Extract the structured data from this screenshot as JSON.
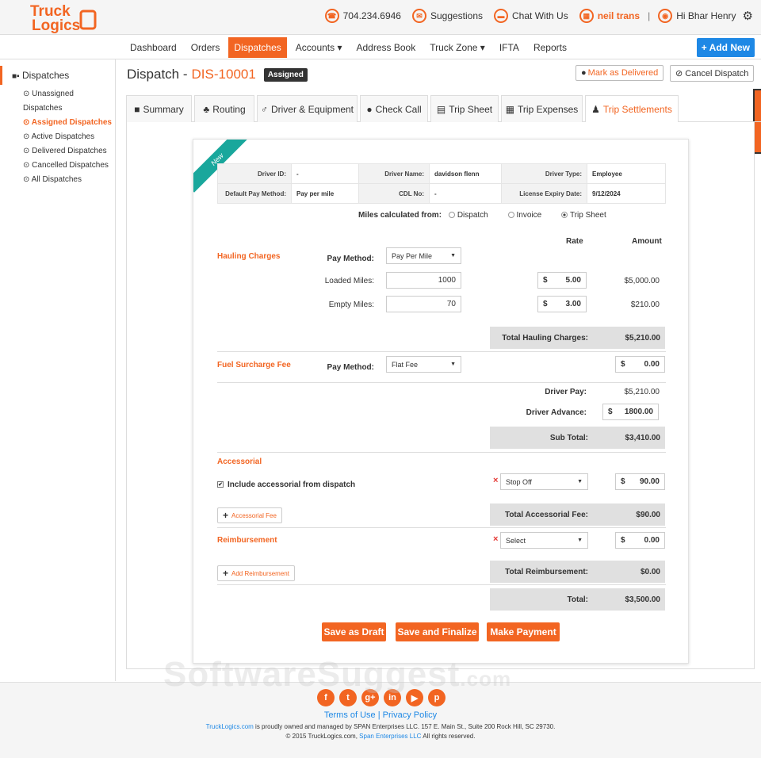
{
  "brand": {
    "name_top": "Truck",
    "name_bottom": "Logics",
    "accent": "#f26522",
    "blue": "#1e88e5",
    "teal": "#19a79c"
  },
  "topbar": {
    "phone": "704.234.6946",
    "suggestions": "Suggestions",
    "chat": "Chat With Us",
    "company": "neil trans",
    "separator": "|",
    "greeting": "Hi Bhar Henry"
  },
  "nav": {
    "items": [
      "Dashboard",
      "Orders",
      "Dispatches",
      "Accounts ▾",
      "Address Book",
      "Truck Zone ▾",
      "IFTA",
      "Reports"
    ],
    "add_new": "+ Add New"
  },
  "sidebar": {
    "header": "Dispatches",
    "items": [
      "Unassigned Dispatches",
      "Assigned Dispatches",
      "Active Dispatches",
      "Delivered Dispatches",
      "Cancelled Dispatches",
      "All Dispatches"
    ]
  },
  "page": {
    "title": "Dispatch -",
    "id": "DIS-10001",
    "status": "Assigned",
    "mark_delivered": "Mark as Delivered",
    "cancel": "Cancel Dispatch"
  },
  "tabs": [
    "Summary",
    "Routing",
    "Driver & Equipment",
    "Check Call",
    "Trip Sheet",
    "Trip Expenses",
    "Trip Settlements"
  ],
  "card": {
    "ribbon": "New",
    "info": {
      "driver_id_label": "Driver ID:",
      "driver_id": "-",
      "driver_name_label": "Driver Name:",
      "driver_name": "davidson flenn",
      "driver_type_label": "Driver Type:",
      "driver_type": "Employee",
      "pay_method_label": "Default Pay Method:",
      "pay_method": "Pay per mile",
      "cdl_label": "CDL No:",
      "cdl": "-",
      "license_label": "License Expiry Date:",
      "license": "9/12/2024"
    },
    "miles_from": {
      "label": "Miles calculated from:",
      "options": [
        "Dispatch",
        "Invoice",
        "Trip Sheet"
      ],
      "selected": "Trip Sheet"
    },
    "rate_header": "Rate",
    "amount_header": "Amount",
    "hauling": {
      "title": "Hauling Charges",
      "pay_method_label": "Pay Method:",
      "pay_method": "Pay Per Mile",
      "loaded_label": "Loaded Miles:",
      "loaded": "1000",
      "loaded_rate": "5.00",
      "loaded_amount": "$5,000.00",
      "empty_label": "Empty Miles:",
      "empty": "70",
      "empty_rate": "3.00",
      "empty_amount": "$210.00",
      "total_label": "Total Hauling Charges:",
      "total": "$5,210.00"
    },
    "fuel": {
      "title": "Fuel Surcharge Fee",
      "pay_method_label": "Pay Method:",
      "pay_method": "Flat Fee",
      "amount": "0.00"
    },
    "pay": {
      "driver_pay_label": "Driver Pay:",
      "driver_pay": "$5,210.00",
      "advance_label": "Driver Advance:",
      "advance": "1800.00",
      "subtotal_label": "Sub Total:",
      "subtotal": "$3,410.00"
    },
    "accessorial": {
      "title": "Accessorial",
      "include_label": "Include accessorial from dispatch",
      "type": "Stop Off",
      "amount": "90.00",
      "add_label": "Accessorial Fee",
      "total_label": "Total Accessorial Fee:",
      "total": "$90.00"
    },
    "reimbursement": {
      "title": "Reimbursement",
      "type": "Select",
      "amount": "0.00",
      "add_label": "Add Reimbursement",
      "total_label": "Total Reimbursement:",
      "total": "$0.00"
    },
    "grand_total_label": "Total:",
    "grand_total": "$3,500.00",
    "currency": "$",
    "buttons": {
      "draft": "Save as Draft",
      "finalize": "Save and Finalize",
      "payment": "Make Payment"
    }
  },
  "watermark": {
    "main": "SoftwareSuggest",
    "suffix": ".com"
  },
  "footer": {
    "social": [
      "f",
      "t",
      "g+",
      "in",
      "▶",
      "p"
    ],
    "terms": "Terms of Use",
    "privacy": "Privacy Policy",
    "divider": "|",
    "site": "TruckLogics.com",
    "owned_text": " is proudly owned and managed by SPAN Enterprises LLC. 157 E. Main St., Suite 200 Rock Hill, SC 29730.",
    "copyright_prefix": "© 2015 TruckLogics.com, ",
    "span_link": "Span Enterprises LLC",
    "copyright_suffix": " All rights reserved."
  }
}
